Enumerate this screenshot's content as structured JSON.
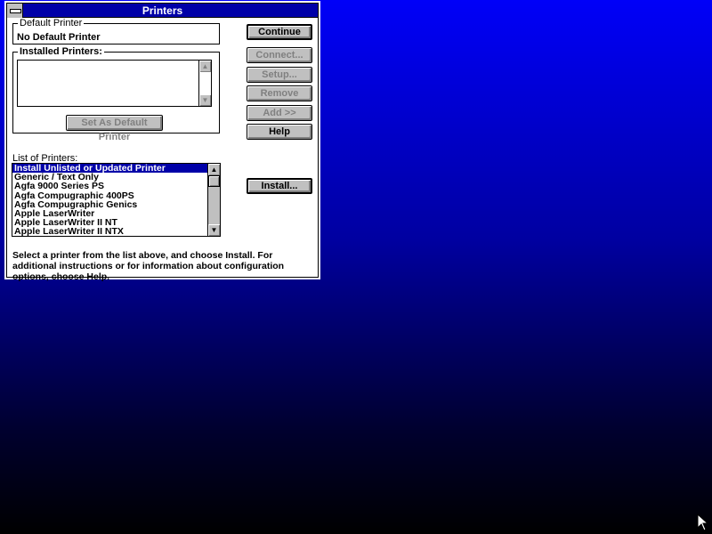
{
  "window": {
    "title": "Printers"
  },
  "default_printer": {
    "label": "Default Printer",
    "value": "No Default Printer"
  },
  "installed": {
    "label": "Installed Printers:",
    "items": [],
    "set_default": "Set As Default Printer"
  },
  "buttons": {
    "continue": "Continue",
    "connect": "Connect...",
    "setup": "Setup...",
    "remove": "Remove",
    "add": "Add >>",
    "help": "Help",
    "install": "Install..."
  },
  "list": {
    "label": "List of Printers:",
    "items": [
      "Install Unlisted or Updated Printer",
      "Generic / Text Only",
      "Agfa 9000 Series PS",
      "Agfa Compugraphic 400PS",
      "Agfa Compugraphic Genics",
      "Apple LaserWriter",
      "Apple LaserWriter II NT",
      "Apple LaserWriter II NTX"
    ]
  },
  "instructions": "Select a printer from the list above, and choose Install. For additional instructions or for information about configuration options, choose Help."
}
